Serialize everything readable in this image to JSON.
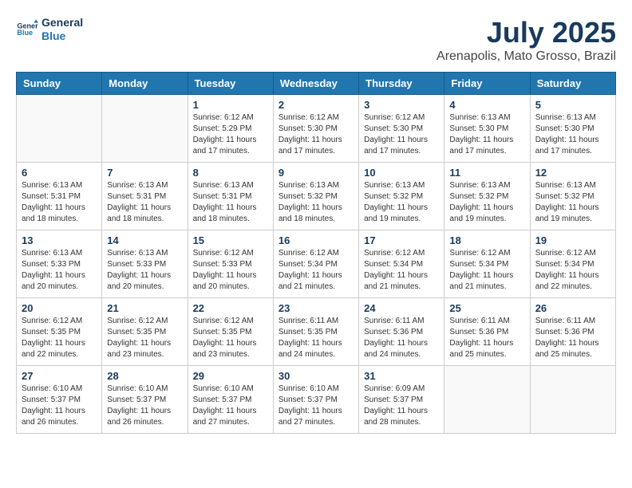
{
  "logo": {
    "line1": "General",
    "line2": "Blue"
  },
  "title": "July 2025",
  "subtitle": "Arenapolis, Mato Grosso, Brazil",
  "weekdays": [
    "Sunday",
    "Monday",
    "Tuesday",
    "Wednesday",
    "Thursday",
    "Friday",
    "Saturday"
  ],
  "weeks": [
    [
      {
        "day": "",
        "info": ""
      },
      {
        "day": "",
        "info": ""
      },
      {
        "day": "1",
        "info": "Sunrise: 6:12 AM\nSunset: 5:29 PM\nDaylight: 11 hours and 17 minutes."
      },
      {
        "day": "2",
        "info": "Sunrise: 6:12 AM\nSunset: 5:30 PM\nDaylight: 11 hours and 17 minutes."
      },
      {
        "day": "3",
        "info": "Sunrise: 6:12 AM\nSunset: 5:30 PM\nDaylight: 11 hours and 17 minutes."
      },
      {
        "day": "4",
        "info": "Sunrise: 6:13 AM\nSunset: 5:30 PM\nDaylight: 11 hours and 17 minutes."
      },
      {
        "day": "5",
        "info": "Sunrise: 6:13 AM\nSunset: 5:30 PM\nDaylight: 11 hours and 17 minutes."
      }
    ],
    [
      {
        "day": "6",
        "info": "Sunrise: 6:13 AM\nSunset: 5:31 PM\nDaylight: 11 hours and 18 minutes."
      },
      {
        "day": "7",
        "info": "Sunrise: 6:13 AM\nSunset: 5:31 PM\nDaylight: 11 hours and 18 minutes."
      },
      {
        "day": "8",
        "info": "Sunrise: 6:13 AM\nSunset: 5:31 PM\nDaylight: 11 hours and 18 minutes."
      },
      {
        "day": "9",
        "info": "Sunrise: 6:13 AM\nSunset: 5:32 PM\nDaylight: 11 hours and 18 minutes."
      },
      {
        "day": "10",
        "info": "Sunrise: 6:13 AM\nSunset: 5:32 PM\nDaylight: 11 hours and 19 minutes."
      },
      {
        "day": "11",
        "info": "Sunrise: 6:13 AM\nSunset: 5:32 PM\nDaylight: 11 hours and 19 minutes."
      },
      {
        "day": "12",
        "info": "Sunrise: 6:13 AM\nSunset: 5:32 PM\nDaylight: 11 hours and 19 minutes."
      }
    ],
    [
      {
        "day": "13",
        "info": "Sunrise: 6:13 AM\nSunset: 5:33 PM\nDaylight: 11 hours and 20 minutes."
      },
      {
        "day": "14",
        "info": "Sunrise: 6:13 AM\nSunset: 5:33 PM\nDaylight: 11 hours and 20 minutes."
      },
      {
        "day": "15",
        "info": "Sunrise: 6:12 AM\nSunset: 5:33 PM\nDaylight: 11 hours and 20 minutes."
      },
      {
        "day": "16",
        "info": "Sunrise: 6:12 AM\nSunset: 5:34 PM\nDaylight: 11 hours and 21 minutes."
      },
      {
        "day": "17",
        "info": "Sunrise: 6:12 AM\nSunset: 5:34 PM\nDaylight: 11 hours and 21 minutes."
      },
      {
        "day": "18",
        "info": "Sunrise: 6:12 AM\nSunset: 5:34 PM\nDaylight: 11 hours and 21 minutes."
      },
      {
        "day": "19",
        "info": "Sunrise: 6:12 AM\nSunset: 5:34 PM\nDaylight: 11 hours and 22 minutes."
      }
    ],
    [
      {
        "day": "20",
        "info": "Sunrise: 6:12 AM\nSunset: 5:35 PM\nDaylight: 11 hours and 22 minutes."
      },
      {
        "day": "21",
        "info": "Sunrise: 6:12 AM\nSunset: 5:35 PM\nDaylight: 11 hours and 23 minutes."
      },
      {
        "day": "22",
        "info": "Sunrise: 6:12 AM\nSunset: 5:35 PM\nDaylight: 11 hours and 23 minutes."
      },
      {
        "day": "23",
        "info": "Sunrise: 6:11 AM\nSunset: 5:35 PM\nDaylight: 11 hours and 24 minutes."
      },
      {
        "day": "24",
        "info": "Sunrise: 6:11 AM\nSunset: 5:36 PM\nDaylight: 11 hours and 24 minutes."
      },
      {
        "day": "25",
        "info": "Sunrise: 6:11 AM\nSunset: 5:36 PM\nDaylight: 11 hours and 25 minutes."
      },
      {
        "day": "26",
        "info": "Sunrise: 6:11 AM\nSunset: 5:36 PM\nDaylight: 11 hours and 25 minutes."
      }
    ],
    [
      {
        "day": "27",
        "info": "Sunrise: 6:10 AM\nSunset: 5:37 PM\nDaylight: 11 hours and 26 minutes."
      },
      {
        "day": "28",
        "info": "Sunrise: 6:10 AM\nSunset: 5:37 PM\nDaylight: 11 hours and 26 minutes."
      },
      {
        "day": "29",
        "info": "Sunrise: 6:10 AM\nSunset: 5:37 PM\nDaylight: 11 hours and 27 minutes."
      },
      {
        "day": "30",
        "info": "Sunrise: 6:10 AM\nSunset: 5:37 PM\nDaylight: 11 hours and 27 minutes."
      },
      {
        "day": "31",
        "info": "Sunrise: 6:09 AM\nSunset: 5:37 PM\nDaylight: 11 hours and 28 minutes."
      },
      {
        "day": "",
        "info": ""
      },
      {
        "day": "",
        "info": ""
      }
    ]
  ]
}
